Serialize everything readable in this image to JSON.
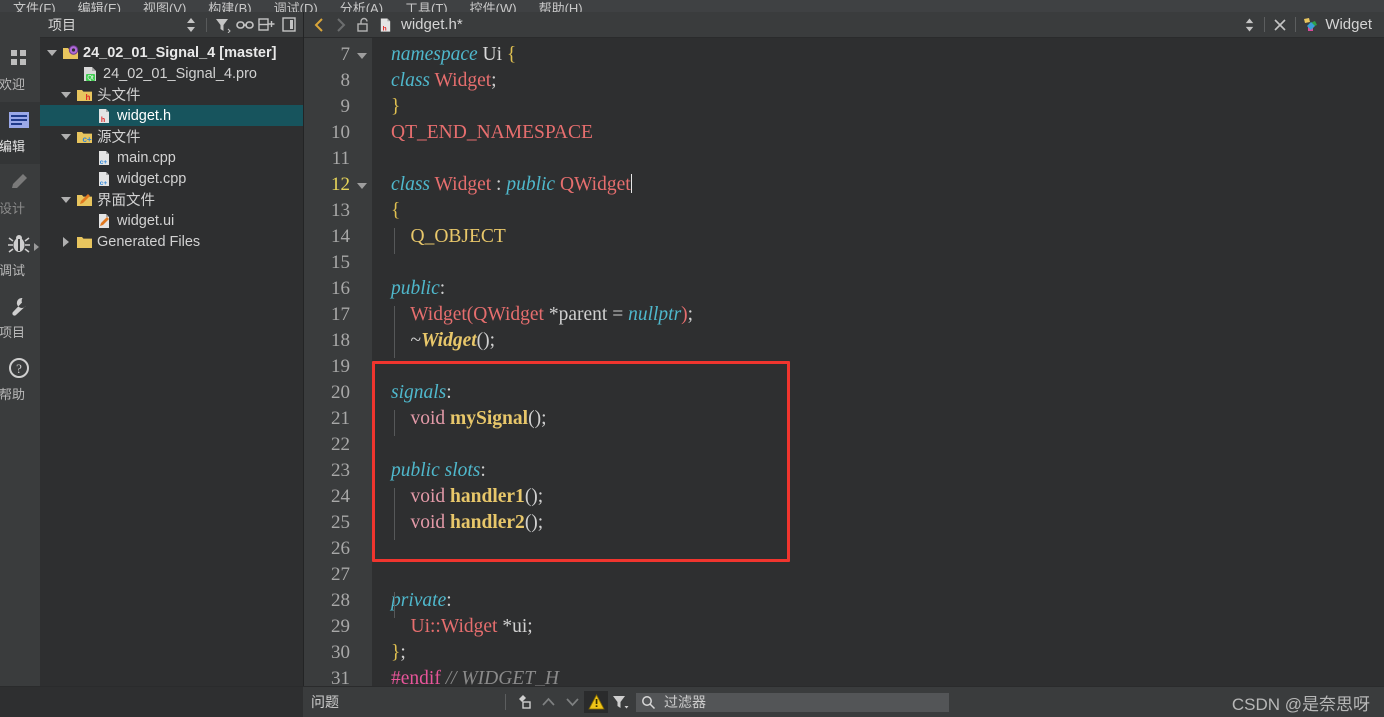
{
  "menubar": {
    "items": [
      {
        "label": "文件(F)"
      },
      {
        "label": "编辑(E)"
      },
      {
        "label": "视图(V)"
      },
      {
        "label": "构建(B)"
      },
      {
        "label": "调试(D)"
      },
      {
        "label": "分析(A)"
      },
      {
        "label": "工具(T)"
      },
      {
        "label": "控件(W)"
      },
      {
        "label": "帮助(H)"
      }
    ]
  },
  "modebar": {
    "items": [
      {
        "label": "欢迎",
        "icon": "welcome-grid-icon",
        "active": false
      },
      {
        "label": "编辑",
        "icon": "edit-lines-icon",
        "active": true
      },
      {
        "label": "设计",
        "icon": "design-pencil-icon",
        "active": false
      },
      {
        "label": "调试",
        "icon": "debug-bug-icon",
        "active": false
      },
      {
        "label": "项目",
        "icon": "project-wrench-icon",
        "active": false
      },
      {
        "label": "帮助",
        "icon": "help-question-icon",
        "active": false
      }
    ]
  },
  "sidebar": {
    "title": "项目",
    "header_icons": [
      {
        "name": "sync-updown-icon"
      },
      {
        "name": "filter-icon"
      },
      {
        "name": "link-icon"
      },
      {
        "name": "split-add-icon"
      },
      {
        "name": "close-panel-icon"
      }
    ],
    "tree": [
      {
        "label": "24_02_01_Signal_4 [master]",
        "indent": 0,
        "twisty": "down",
        "icon": "qt-project-icon",
        "selected": false,
        "bold": true
      },
      {
        "label": "24_02_01_Signal_4.pro",
        "indent": 1,
        "twisty": "none",
        "icon": "pro-file-icon",
        "selected": false,
        "bold": false
      },
      {
        "label": "头文件",
        "indent": 1,
        "twisty": "down",
        "icon": "folder-h-icon",
        "selected": false,
        "bold": false
      },
      {
        "label": "widget.h",
        "indent": 2,
        "twisty": "none",
        "icon": "header-file-icon",
        "selected": true,
        "bold": false
      },
      {
        "label": "源文件",
        "indent": 1,
        "twisty": "down",
        "icon": "folder-cpp-icon",
        "selected": false,
        "bold": false
      },
      {
        "label": "main.cpp",
        "indent": 2,
        "twisty": "none",
        "icon": "cpp-file-icon",
        "selected": false,
        "bold": false
      },
      {
        "label": "widget.cpp",
        "indent": 2,
        "twisty": "none",
        "icon": "cpp-file-icon",
        "selected": false,
        "bold": false
      },
      {
        "label": "界面文件",
        "indent": 1,
        "twisty": "down",
        "icon": "folder-ui-icon",
        "selected": false,
        "bold": false
      },
      {
        "label": "widget.ui",
        "indent": 2,
        "twisty": "none",
        "icon": "ui-file-icon",
        "selected": false,
        "bold": false
      },
      {
        "label": "Generated Files",
        "indent": 1,
        "twisty": "right",
        "icon": "folder-icon",
        "selected": false,
        "bold": false
      }
    ]
  },
  "tabbar": {
    "back_icon": "chevron-left-icon",
    "forward_icon": "chevron-right-icon",
    "lock_icon": "unlocked-icon",
    "file_icon": "header-file-icon",
    "filename": "widget.h*",
    "updown_icon": "sort-updown-icon",
    "close_icon": "close-icon",
    "symbol_icon": "qt-class-icon",
    "symbol": "Widget"
  },
  "editor": {
    "first_line": 7,
    "lines": [
      {
        "n": 7,
        "fold": true,
        "current": false,
        "indent": 0
      },
      {
        "n": 8,
        "fold": false,
        "current": false,
        "indent": 0
      },
      {
        "n": 9,
        "fold": false,
        "current": false,
        "indent": 0
      },
      {
        "n": 10,
        "fold": false,
        "current": false,
        "indent": 0
      },
      {
        "n": 11,
        "fold": false,
        "current": false,
        "indent": 0
      },
      {
        "n": 12,
        "fold": true,
        "current": true,
        "indent": 0
      },
      {
        "n": 13,
        "fold": false,
        "current": false,
        "indent": 0
      },
      {
        "n": 14,
        "fold": false,
        "current": false,
        "indent": 1
      },
      {
        "n": 15,
        "fold": false,
        "current": false,
        "indent": 0
      },
      {
        "n": 16,
        "fold": false,
        "current": false,
        "indent": 0
      },
      {
        "n": 17,
        "fold": false,
        "current": false,
        "indent": 1
      },
      {
        "n": 18,
        "fold": false,
        "current": false,
        "indent": 1
      },
      {
        "n": 19,
        "fold": false,
        "current": false,
        "indent": 0
      },
      {
        "n": 20,
        "fold": false,
        "current": false,
        "indent": 0
      },
      {
        "n": 21,
        "fold": false,
        "current": false,
        "indent": 1
      },
      {
        "n": 22,
        "fold": false,
        "current": false,
        "indent": 0
      },
      {
        "n": 23,
        "fold": false,
        "current": false,
        "indent": 0
      },
      {
        "n": 24,
        "fold": false,
        "current": false,
        "indent": 1
      },
      {
        "n": 25,
        "fold": false,
        "current": false,
        "indent": 1
      },
      {
        "n": 26,
        "fold": false,
        "current": false,
        "indent": 0
      },
      {
        "n": 27,
        "fold": false,
        "current": false,
        "indent": 0
      },
      {
        "n": 28,
        "fold": false,
        "current": false,
        "indent": 0
      },
      {
        "n": 29,
        "fold": false,
        "current": false,
        "indent": 1
      },
      {
        "n": 30,
        "fold": false,
        "current": false,
        "indent": 0
      },
      {
        "n": 31,
        "fold": false,
        "current": false,
        "indent": 0
      }
    ],
    "code": [
      "namespace Ui {",
      "class Widget;",
      "}",
      "QT_END_NAMESPACE",
      "",
      "class Widget : public QWidget",
      "{",
      "    Q_OBJECT",
      "",
      "public:",
      "    Widget(QWidget *parent = nullptr);",
      "    ~Widget();",
      "",
      "signals:",
      "    void mySignal();",
      "",
      "public slots:",
      "    void handler1();",
      "    void handler2();",
      "",
      "",
      "private:",
      "    Ui::Widget *ui;",
      "};",
      "#endif // WIDGET_H"
    ],
    "annotation": {
      "name": "red-highlight-box",
      "color": "#f0352e"
    }
  },
  "bottombar": {
    "title": "问题",
    "icons": [
      {
        "name": "clear-filter-icon"
      },
      {
        "name": "chevron-up-icon"
      },
      {
        "name": "chevron-down-icon"
      },
      {
        "name": "warning-icon"
      },
      {
        "name": "filter-dropdown-icon"
      }
    ],
    "search_icon": "search-icon",
    "filter_placeholder": "过滤器"
  },
  "watermark": "CSDN @是奈思呀"
}
